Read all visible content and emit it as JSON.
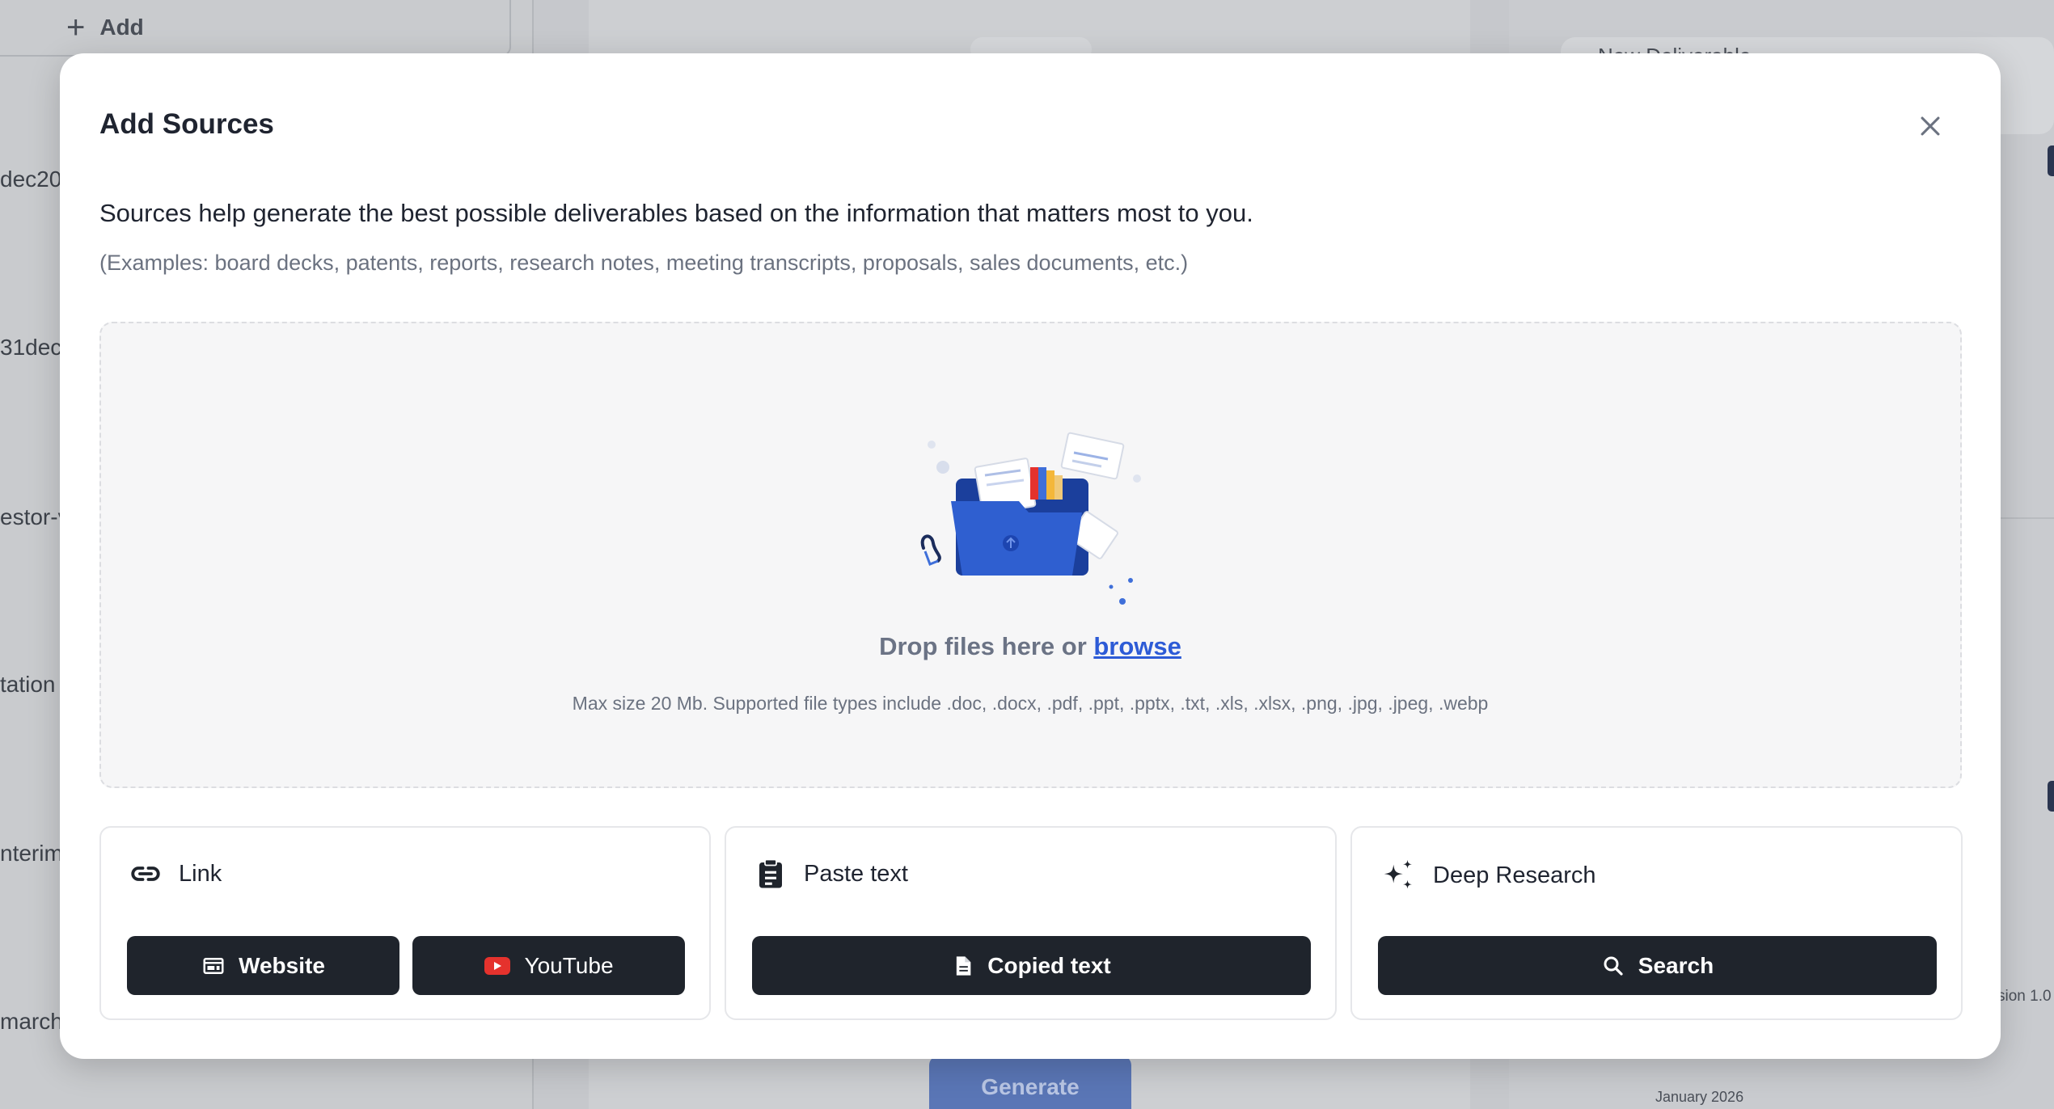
{
  "background": {
    "add_label": "Add",
    "list_fragments": [
      "dec20",
      "31dec2",
      "estor-v",
      "tation",
      "nterim",
      "march"
    ],
    "generate_label": "Generate",
    "right_heading": "New Deliverable",
    "version_fragment": "sion 1.0",
    "date_label": "January 2026"
  },
  "modal": {
    "title": "Add Sources",
    "close_icon": "close-icon",
    "intro": "Sources help generate the best possible deliverables based on the information that matters most to you.",
    "examples": "(Examples: board decks, patents, reports, research notes, meeting transcripts, proposals, sales documents, etc.)",
    "dropzone": {
      "prompt": "Drop files here or ",
      "browse_label": "browse",
      "limits": "Max size 20 Mb. Supported file types include .doc, .docx, .pdf, .ppt, .pptx, .txt, .xls, .xlsx, .png, .jpg, .jpeg, .webp"
    },
    "cards": {
      "link": {
        "label": "Link",
        "icon": "link-icon",
        "website_label": "Website",
        "youtube_label": "YouTube"
      },
      "paste": {
        "label": "Paste text",
        "icon": "clipboard-icon",
        "copied_label": "Copied text"
      },
      "research": {
        "label": "Deep Research",
        "icon": "sparkles-icon",
        "search_label": "Search"
      }
    }
  },
  "colors": {
    "button_bg": "#1f242c",
    "link_blue": "#2d5bd6",
    "youtube_red": "#e5322d"
  }
}
